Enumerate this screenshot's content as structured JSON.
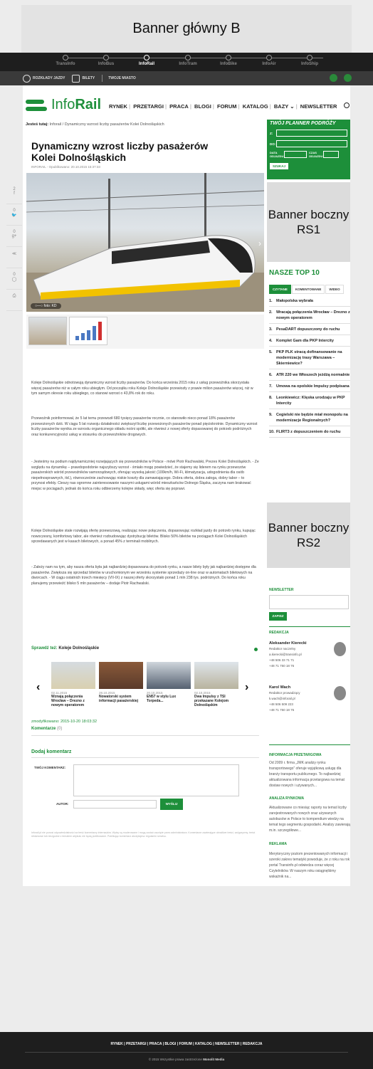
{
  "banner_main": "Banner główny B",
  "network_nav": [
    {
      "label": "TransInfo",
      "active": false
    },
    {
      "label": "InfoBus",
      "active": false
    },
    {
      "label": "InfoRail",
      "active": true
    },
    {
      "label": "InfoTram",
      "active": false
    },
    {
      "label": "InfoBike",
      "active": false
    },
    {
      "label": "InfoAir",
      "active": false
    },
    {
      "label": "InfoShip",
      "active": false
    }
  ],
  "sub_nav": {
    "timetables": "ROZKŁADY JAZDY",
    "tickets": "BILETY",
    "your_city": "TWOJE MIASTO"
  },
  "logo": {
    "prefix": "Info",
    "bold": "Rail"
  },
  "main_menu": [
    "RYNEK",
    "PRZETARGI",
    "PRACA",
    "BLOGI",
    "FORUM",
    "KATALOG",
    "BAZY",
    "NEWSLETTER"
  ],
  "breadcrumb": {
    "lead": "Jesteś tutaj:",
    "home": "Inforail",
    "current": "Dynamiczny wzrost liczby pasażerów Kolei Dolnośląskich"
  },
  "article": {
    "title": "Dynamiczny wzrost liczby pasażerów Kolei Dolnośląskich",
    "meta": "INFORAIL - Opublikowano: 20.10.2015 15:37:33",
    "photo_caption": "foto: KD",
    "paragraphs": [
      "Koleje Dolnośląskie odnotowują dynamiczny wzrost liczby pasażerów. Do końca września 2015 roku z usług przewoźnika skorzystała więcej pasażerów niż w całym roku ubiegłym. Od początku roku Koleje Dolnośląskie przewiozły z prawie milion pasażerów więcej, niż w tym samym okresie roku ubiegłego, co stanowi wzrost o 43,8% rok do roku.",
      "Przewoźnik poinformował, że 5 lat temu przewoził 680 tysięcy pasażerów rocznie, co stanowiło nieco ponad 18% pasażerów przewożonych dziś. W ciągu 5 lat rozwoju działalności zwiększył liczbę przewożonych pasażerów ponad pięciokrotnie. Dynamiczny wzrost liczby pasażerów wynika ze wzrostu organicznego składu nośni spółki, ale również z nowej oferty dopasowanej do potrzeb podróżnych oraz konkurencyjności usług w stosunku do przewoźników drogowych.",
      "- Jesteśmy na podium najdynamiczniej rozwijających się przewoźników w Polsce - mówi Piotr Rachwalski, Prezes Kolei Dolnośląskich. - Ze względu na dynamikę – prawdopodobnie najszybszy wzrost - śmiało mogę powiedzieć, że stajemy się liderem na rynku przewozów pasażerskich wśród przewoźników samorządowych, oferując wysoką jakość (100km/h, Wi-Fi, klimatyzacja, udogodnienia dla osób niepełnosprawnych, itd.), równocześnie zachowując niskie koszty dla zamawiającego. Dobra oferta, dobra załoga, dobry tabor – to przynosi efekty. Cieszy nas ogromne zainteresowanie naszymi usługami wśród mieszkańców Dolnego Śląska, zaczyna nam brakować miejsc w pociągach, jednak do końca roku odbierzemy kolejne składy, więc oferta się poprawi.",
      "Koleje Dolnośląskie stale rozwijają ofertę przewozową, realizując nowe połączenia, dopasowując rozkład jazdy do potrzeb rynku, kupując nowoczesny, komfortowy tabor, ale również rozbudowując dystrybucję biletów. Blisko 50% biletów na pociągach Kolei Dolnośląskich sprzedawanych jest w kasach biletowych, a ponad 45% z terminali mobilnych.",
      "- Zależy nam na tym, aby nasza oferta była jak najbardziej dopasowana do potrzeb rynku, a nasze bilety były jak najbardziej dostępne dla pasażerów. Zwiększa się sprzedaż biletów w uruchomionym we wrześniu systemie sprzedaży on-line oraz w automatach biletowych na dworcach. - W ciągu ostatnich trzech miesięcy (VII-IX) z naszej oferty skorzystało ponad 1 mln 238 tys. podróżnych. Do końca roku planujemy przewieźć blisko 5 mln pasażerów – dodaje Piotr Rachwalski."
    ],
    "related_label": "Sprawdź też:",
    "related_topic": "Koleje Dolnośląskie",
    "related": [
      {
        "date": "02.11.2015",
        "title": "Wznają połączenia Wrocław – Drezno z nowym operatorem"
      },
      {
        "date": "28.10.2015",
        "title": "Nowatorski system informacji pasażerskiej"
      },
      {
        "date": "20.10.2015",
        "title": "EN57 w stylu Lux Torpeda..."
      },
      {
        "date": "02.10.2015",
        "title": "Dwa Impulsy z TSI przekazane Kolejom Dolnośląskim"
      }
    ],
    "modified": "zmodyfikowano: 2015-10-20 18:03:32",
    "comments_label": "Komentarze",
    "comments_count": "(0)",
    "add_comment": "Dodaj komentarz",
    "your_comment": "TWÓJ KOMENTARZ:",
    "author": "AUTOR:",
    "send": "WYŚLIJ",
    "disclaimer": "Inforail.pl nie ponosi odpowiedzialności za treść komentarzy internautów. Wpisy są moderowane i mogą zostać usunięte przez administratora. Komentarze zawierające obraźliwe treści, wulgaryzmy, treści reklamowe lub niezgodne z tematem artykułu nie będą publikowane. Publikując komentarz akceptujesz regulamin serwisu."
  },
  "sidebar": {
    "planner_title": "TWÓJ PLANNER PODRÓŻY",
    "from": "Z:",
    "to": "DO:",
    "date_label": "DATA ODJAZDU",
    "time_label": "CZAS ODJAZDU",
    "search": "SZUKAJ",
    "banner_rs1": "Banner boczny RS1",
    "top10_title": "NASZE TOP 10",
    "tabs": [
      "CZYTANE",
      "KOMENTOWANE",
      "WIDEO"
    ],
    "top10": [
      "Małopolska wybrała",
      "Wracają połączenia Wrocław – Drezno z nowym operatorem",
      "PesaDART dopuszczony do ruchu",
      "Komplet Gam dla PKP Intercity",
      "PKP PLK stracą dofinansowanie na modernizację trasy Warszawa – Skierniewice?",
      "ATR 220 we Włoszech jeżdżą normalnie",
      "Umowa na opolskie Impulsy podpisana",
      "Leonkiewicz: Klęska urodzaju w PKP Intercity",
      "Cegielski nie będzie miał monopolu na modernizacje Regionalnych?",
      "FLIRT3 z dopuszczeniem do ruchu"
    ],
    "banner_rs2": "Banner boczny RS2",
    "newsletter_title": "NEWSLETTER",
    "newsletter_btn": "ZAPISZ",
    "editors_title": "REDAKCJA",
    "editors": [
      {
        "name": "Aleksander Kierecki",
        "role": "Redaktor naczelny",
        "email": "a.kierecki@transinfo.pl",
        "phone1": "+48 506 33 71 71",
        "phone2": "+48 71 750 18 76"
      },
      {
        "name": "Karol Wach",
        "role": "Redaktor prowadzący",
        "email": "k.wach@inforail.pl",
        "phone1": "+48 506 509 223",
        "phone2": "+48 71 750 18 76"
      }
    ],
    "info_title": "INFORMACJA PRZETARGOWA",
    "info_text": "Od 2009 r. firma „JMK analizy rynku transportowego” oferuje wyjątkową usługę dla branży transportu publicznego. To najbardziej aktualizowana informacja przetargowa na temat dostaw nowych i używanych...",
    "analysis_title": "ANALIZA RYNKOWA",
    "analysis_text": "Aktualizowane co miesiąc raporty na temat liczby zarejestrowanych nowych oraz używanych autobusów w Polsce to kompendium wiedzy na temat tego segmentu gospodarki. Analizy zawierają m.in. szczegółowe...",
    "ads_title": "REKLAMA",
    "ads_text": "Merytoryczny poziom prezentowanych informacji i szeroki zakres tematyki powoduje, że z roku na rok portal Transinfo.pl odwiedza coraz więcej Czytelników. W naszym roku osiągnęliśmy wskaźnik na..."
  },
  "footer": {
    "menu": "RYNEK  |  PRZETARGI  |  PRACA  |  BLOGI  |  FORUM  |  KATALOG  |  NEWSLETTER  |  REDAKCJA",
    "copyright": "© 2015 Wszystkie prawa zastrzeżone",
    "company": "Monolit Media"
  }
}
